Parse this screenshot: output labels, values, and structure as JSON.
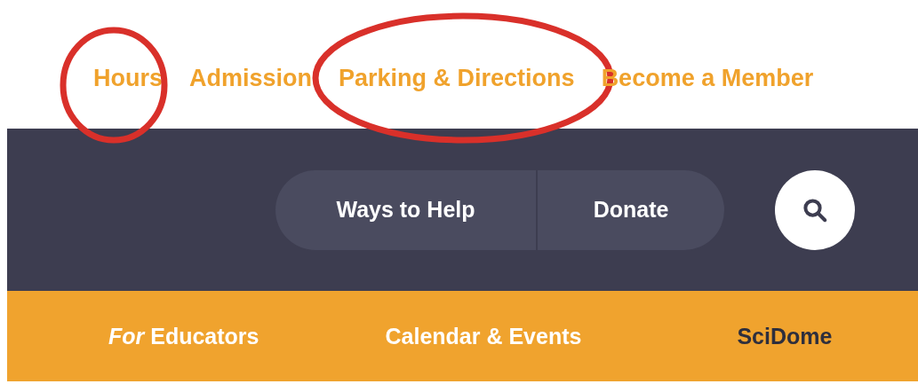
{
  "top_links": [
    {
      "label": "Hours",
      "circled": true
    },
    {
      "label": "Admission",
      "circled": false
    },
    {
      "label": "Parking & Directions",
      "circled": true
    },
    {
      "label": "Become a Member",
      "circled": false
    }
  ],
  "utility_buttons": [
    "Ways to Help",
    "Donate"
  ],
  "nav": [
    {
      "label": "*For* Educators",
      "kind": "light"
    },
    {
      "label": "Calendar & Events",
      "kind": "light"
    },
    {
      "label": "SciDome",
      "kind": "dark"
    }
  ]
}
